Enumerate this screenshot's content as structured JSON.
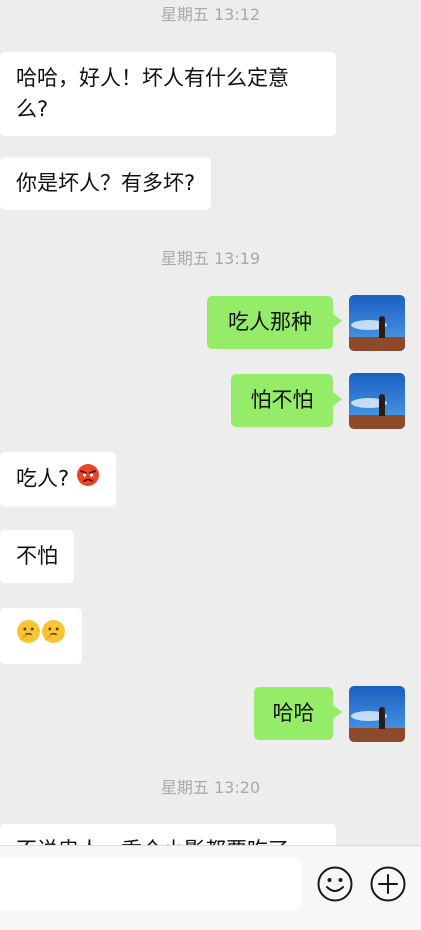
{
  "colors": {
    "background": "#ededed",
    "incoming_bubble": "#ffffff",
    "outgoing_bubble": "#95ec69",
    "timestamp_text": "#a9a9a9"
  },
  "messages": {
    "ts1": "星期五 13:12",
    "m1": "哈哈，好人！坏人有什么定意么?",
    "m2": "你是坏人？有多坏?",
    "ts2": "星期五 13:19",
    "m3": "吃人那种",
    "m4": "怕不怕",
    "m5": "吃人?",
    "m6": "不怕",
    "m8": "哈哈",
    "ts3": "星期五 13:20",
    "m9_partial": "不说忠人，香个小影都要吃了"
  },
  "icons": {
    "avatar": "avatar-image",
    "angry_emoji": "angry-face-emoji",
    "thinking_emoji": "thinking-face-emoji",
    "emoji_button": "smiley-icon",
    "plus_button": "plus-circle-icon"
  },
  "input": {
    "value": "",
    "placeholder": ""
  }
}
